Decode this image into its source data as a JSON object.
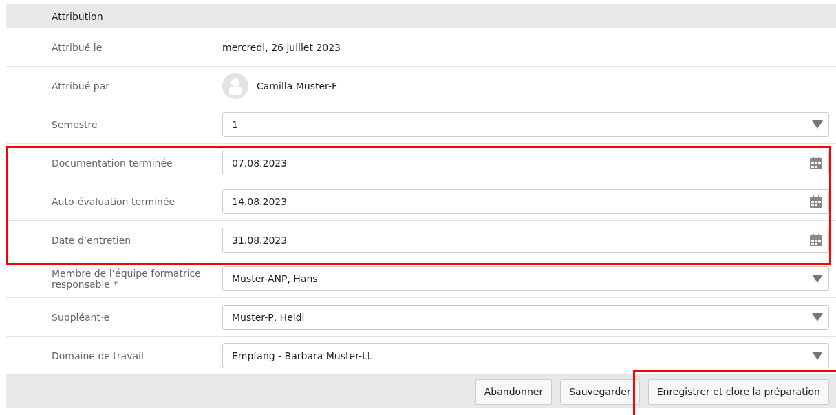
{
  "section": {
    "title": "Attribution"
  },
  "rows": [
    {
      "kind": "text",
      "label": "Attribué le",
      "value": "mercredi, 26 juillet 2023",
      "highlighted": false
    },
    {
      "kind": "user",
      "label": "Attribué par",
      "value": "Camilla Muster-F",
      "highlighted": false
    },
    {
      "kind": "select",
      "label": "Semestre",
      "value": "1",
      "highlighted": false
    },
    {
      "kind": "date",
      "label": "Documentation terminée",
      "value": "07.08.2023",
      "highlighted": true
    },
    {
      "kind": "date",
      "label": "Auto-évaluation terminée",
      "value": "14.08.2023",
      "highlighted": true
    },
    {
      "kind": "date",
      "label": "Date d’entretien",
      "value": "31.08.2023",
      "highlighted": true
    },
    {
      "kind": "select",
      "label": "Membre de l’équipe formatrice responsable *",
      "value": "Muster-ANP, Hans",
      "highlighted": false
    },
    {
      "kind": "select",
      "label": "Suppléant·e",
      "value": "Muster-P, Heidi",
      "highlighted": false
    },
    {
      "kind": "select",
      "label": "Domaine de travail",
      "value": "Empfang - Barbara Muster-LL",
      "highlighted": false
    }
  ],
  "buttons": [
    {
      "label": "Abandonner",
      "highlighted": false
    },
    {
      "label": "Sauvegarder",
      "highlighted": false
    },
    {
      "label": "Enregistrer et clore la préparation",
      "highlighted": true
    }
  ]
}
